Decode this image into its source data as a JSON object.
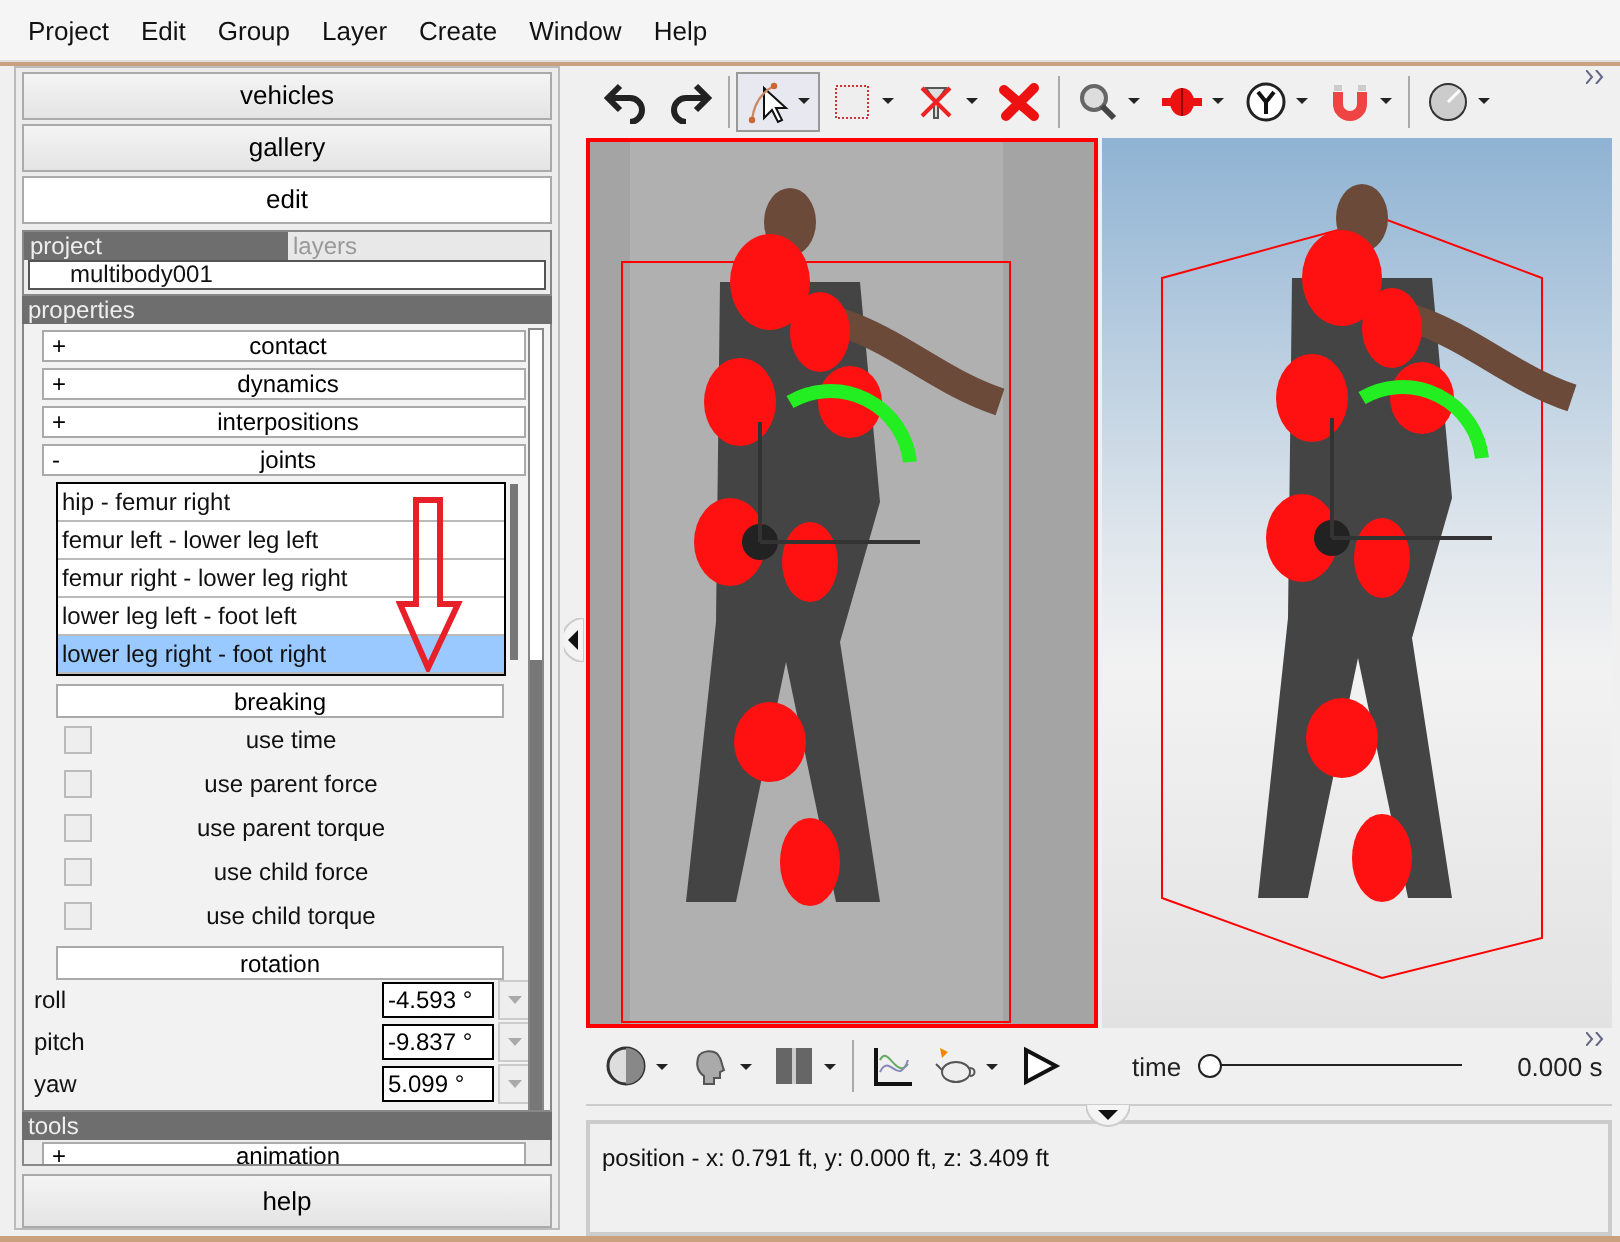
{
  "menu": [
    {
      "label": "Project"
    },
    {
      "label": "Edit"
    },
    {
      "label": "Group"
    },
    {
      "label": "Layer"
    },
    {
      "label": "Create"
    },
    {
      "label": "Window"
    },
    {
      "label": "Help"
    }
  ],
  "sidebar": {
    "nav_buttons": [
      {
        "label": "vehicles",
        "selected": false
      },
      {
        "label": "gallery",
        "selected": false
      },
      {
        "label": "edit",
        "selected": true
      }
    ],
    "project_tabs": [
      {
        "label": "project",
        "selected": true
      },
      {
        "label": "layers",
        "selected": false
      }
    ],
    "project_item": "multibody001",
    "properties_header": "properties",
    "sections": [
      {
        "sign": "+",
        "label": "contact"
      },
      {
        "sign": "+",
        "label": "dynamics"
      },
      {
        "sign": "+",
        "label": "interpositions"
      },
      {
        "sign": "-",
        "label": "joints"
      }
    ],
    "joints": [
      {
        "label": "hip - femur right",
        "selected": false
      },
      {
        "label": "femur left - lower leg left",
        "selected": false
      },
      {
        "label": "femur right - lower leg right",
        "selected": false
      },
      {
        "label": "lower leg left - foot left",
        "selected": false
      },
      {
        "label": "lower leg right - foot right",
        "selected": true
      }
    ],
    "breaking": "breaking",
    "breaking_options": [
      {
        "label": "use time",
        "checked": false
      },
      {
        "label": "use parent force",
        "checked": false
      },
      {
        "label": "use parent torque",
        "checked": false
      },
      {
        "label": "use child force",
        "checked": false
      },
      {
        "label": "use child torque",
        "checked": false
      }
    ],
    "rotation": "rotation",
    "rotation_fields": [
      {
        "label": "roll",
        "value": "-4.593 °"
      },
      {
        "label": "pitch",
        "value": "-9.837 °"
      },
      {
        "label": "yaw",
        "value": "5.099 °"
      }
    ],
    "tools_header": "tools",
    "tools_sections": [
      {
        "sign": "+",
        "label": "animation"
      }
    ],
    "help": "help"
  },
  "top_toolbar": [
    {
      "kind": "undo",
      "selected": false,
      "caret": false
    },
    {
      "kind": "redo",
      "selected": false,
      "caret": false
    },
    {
      "kind": "pointer",
      "selected": true,
      "caret": true
    },
    {
      "kind": "rect",
      "selected": false,
      "caret": true
    },
    {
      "kind": "nodelete",
      "selected": false,
      "caret": true
    },
    {
      "kind": "delete",
      "selected": false,
      "caret": false
    },
    {
      "kind": "zoom",
      "selected": false,
      "caret": true
    },
    {
      "kind": "joint",
      "selected": false,
      "caret": true
    },
    {
      "kind": "ydial",
      "selected": false,
      "caret": true
    },
    {
      "kind": "magnet",
      "selected": false,
      "caret": true
    },
    {
      "kind": "gauge",
      "selected": false,
      "caret": true
    }
  ],
  "bottom_toolbar": [
    {
      "kind": "sphere",
      "caret": true
    },
    {
      "kind": "head",
      "caret": true
    },
    {
      "kind": "split",
      "caret": true
    },
    {
      "kind": "graph",
      "caret": false
    },
    {
      "kind": "teapot",
      "caret": true
    },
    {
      "kind": "play",
      "caret": false
    }
  ],
  "timeline": {
    "label": "time",
    "level": 0,
    "reading": "0.000 s"
  },
  "status": "position - x: 0.791 ft, y: 0.000 ft, z: 3.409 ft"
}
